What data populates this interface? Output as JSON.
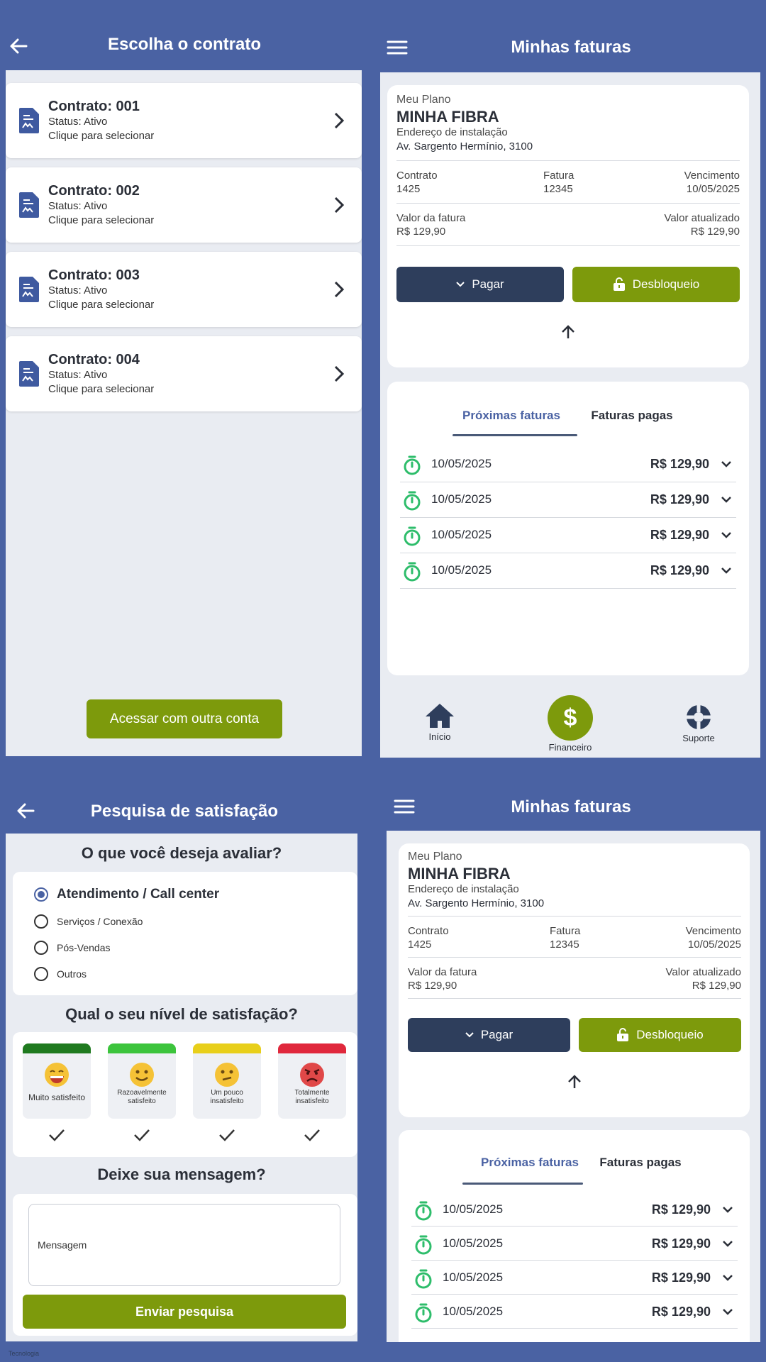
{
  "contracts_screen": {
    "title": "Escolha o contrato",
    "items": [
      {
        "title": "Contrato: 001",
        "status": "Status: Ativo",
        "hint": "Clique para selecionar"
      },
      {
        "title": "Contrato: 002",
        "status": "Status: Ativo",
        "hint": "Clique para selecionar"
      },
      {
        "title": "Contrato: 003",
        "status": "Status: Ativo",
        "hint": "Clique para selecionar"
      },
      {
        "title": "Contrato: 004",
        "status": "Status: Ativo",
        "hint": "Clique para selecionar"
      }
    ],
    "other_account_label": "Acessar com outra conta"
  },
  "invoices": {
    "title": "Minhas faturas",
    "plan_label": "Meu Plano",
    "plan_name": "MINHA FIBRA",
    "address_label": "Endereço de instalação",
    "address": "Av. Sargento Hermínio, 3100",
    "contract_label": "Contrato",
    "contract_value": "1425",
    "invoice_label": "Fatura",
    "invoice_value": "12345",
    "due_label": "Vencimento",
    "due_value": "10/05/2025",
    "amount_label": "Valor da fatura",
    "amount_value": "R$ 129,90",
    "updated_label": "Valor atualizado",
    "updated_value": "R$ 129,90",
    "pay_label": "Pagar",
    "unlock_label": "Desbloqueio",
    "tab_upcoming": "Próximas faturas",
    "tab_paid": "Faturas pagas",
    "rows": [
      {
        "date": "10/05/2025",
        "amount": "R$ 129,90"
      },
      {
        "date": "10/05/2025",
        "amount": "R$ 129,90"
      },
      {
        "date": "10/05/2025",
        "amount": "R$ 129,90"
      },
      {
        "date": "10/05/2025",
        "amount": "R$ 129,90"
      }
    ],
    "nav": {
      "home": "Início",
      "finance": "Financeiro",
      "support": "Suporte"
    }
  },
  "survey": {
    "title": "Pesquisa de satisfação",
    "q1": "O que você deseja avaliar?",
    "options": [
      "Atendimento / Call center",
      "Serviços / Conexão",
      "Pós-Vendas",
      "Outros"
    ],
    "q2": "Qual o seu nível de satisfação?",
    "levels": [
      {
        "label": "Muito satisfeito",
        "color": "#1f7a1f"
      },
      {
        "label": "Razoavelmente satisfeito",
        "color": "#3cc43c"
      },
      {
        "label": "Um pouco insatisfeito",
        "color": "#e8cf1a"
      },
      {
        "label": "Totalmente insatisfeito",
        "color": "#e0283c"
      }
    ],
    "q3": "Deixe sua mensagem?",
    "message_placeholder": "Mensagem",
    "submit_label": "Enviar pesquisa",
    "footer_caption": "Tecnologia"
  },
  "colors": {
    "header_bg": "#4a62a3",
    "green": "#7d9a0c",
    "navy": "#2e3e5c",
    "timer_green": "#2ebd6b"
  }
}
